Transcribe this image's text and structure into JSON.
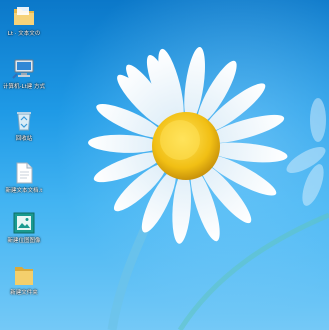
{
  "desktop": {
    "wallpaper": {
      "subject": "white daisy with yellow center on blue background",
      "colors": {
        "sky_top": "#0b78c9",
        "sky_bottom": "#74c9f7",
        "petal": "#ffffff",
        "center": "#f2c41a"
      }
    },
    "icons": [
      {
        "label": "Lt · 文本文の",
        "icon": "folder-icon"
      },
      {
        "label": "计算机-Lt建 方式",
        "icon": "computer-icon"
      },
      {
        "label": "回收站",
        "icon": "recycle-bin-icon"
      },
      {
        "label": "新建文本文档.t",
        "icon": "text-document-icon"
      },
      {
        "label": "新建位图图像",
        "icon": "bitmap-image-icon"
      },
      {
        "label": "新建文件夹",
        "icon": "folder-icon"
      }
    ]
  }
}
